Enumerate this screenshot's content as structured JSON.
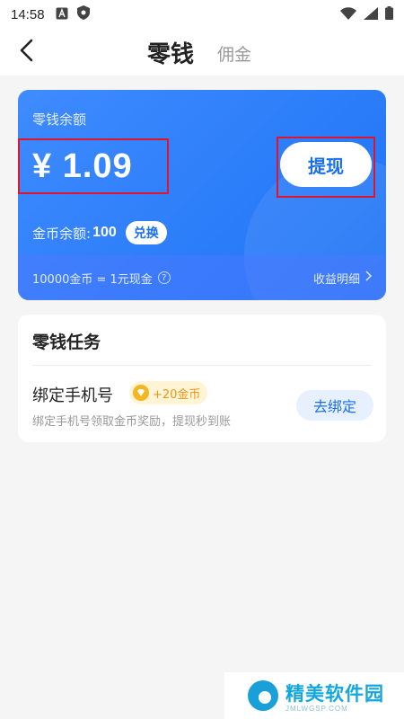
{
  "status_bar": {
    "time": "14:58",
    "icons_left": [
      "a-box-icon",
      "shield-icon"
    ],
    "icons_right": [
      "wifi-icon",
      "signal-icon",
      "battery-icon"
    ]
  },
  "header": {
    "back_icon": "back-arrow-icon",
    "tab_active": "零钱",
    "tab_inactive": "佣金"
  },
  "balance_card": {
    "label": "零钱余额",
    "amount": "¥ 1.09",
    "withdraw_label": "提现",
    "coin_label": "金币余额:",
    "coin_value": "100",
    "exchange_label": "兑换",
    "rate_text": "10000金币 = 1元现金",
    "help_icon": "?",
    "detail_link": "收益明细",
    "detail_icon": "chevron-right-icon",
    "colors": {
      "card_start": "#3f8bff",
      "card_end": "#1e73f5",
      "highlight_border": "#e0142c"
    }
  },
  "tasks": {
    "title": "零钱任务",
    "items": [
      {
        "name": "绑定手机号",
        "reward": "+20金币",
        "description": "绑定手机号领取金币奖励，提现秒到账",
        "action": "去绑定"
      }
    ]
  },
  "watermark": {
    "name": "精美软件园",
    "domain": "JMLWGSP.COM"
  }
}
